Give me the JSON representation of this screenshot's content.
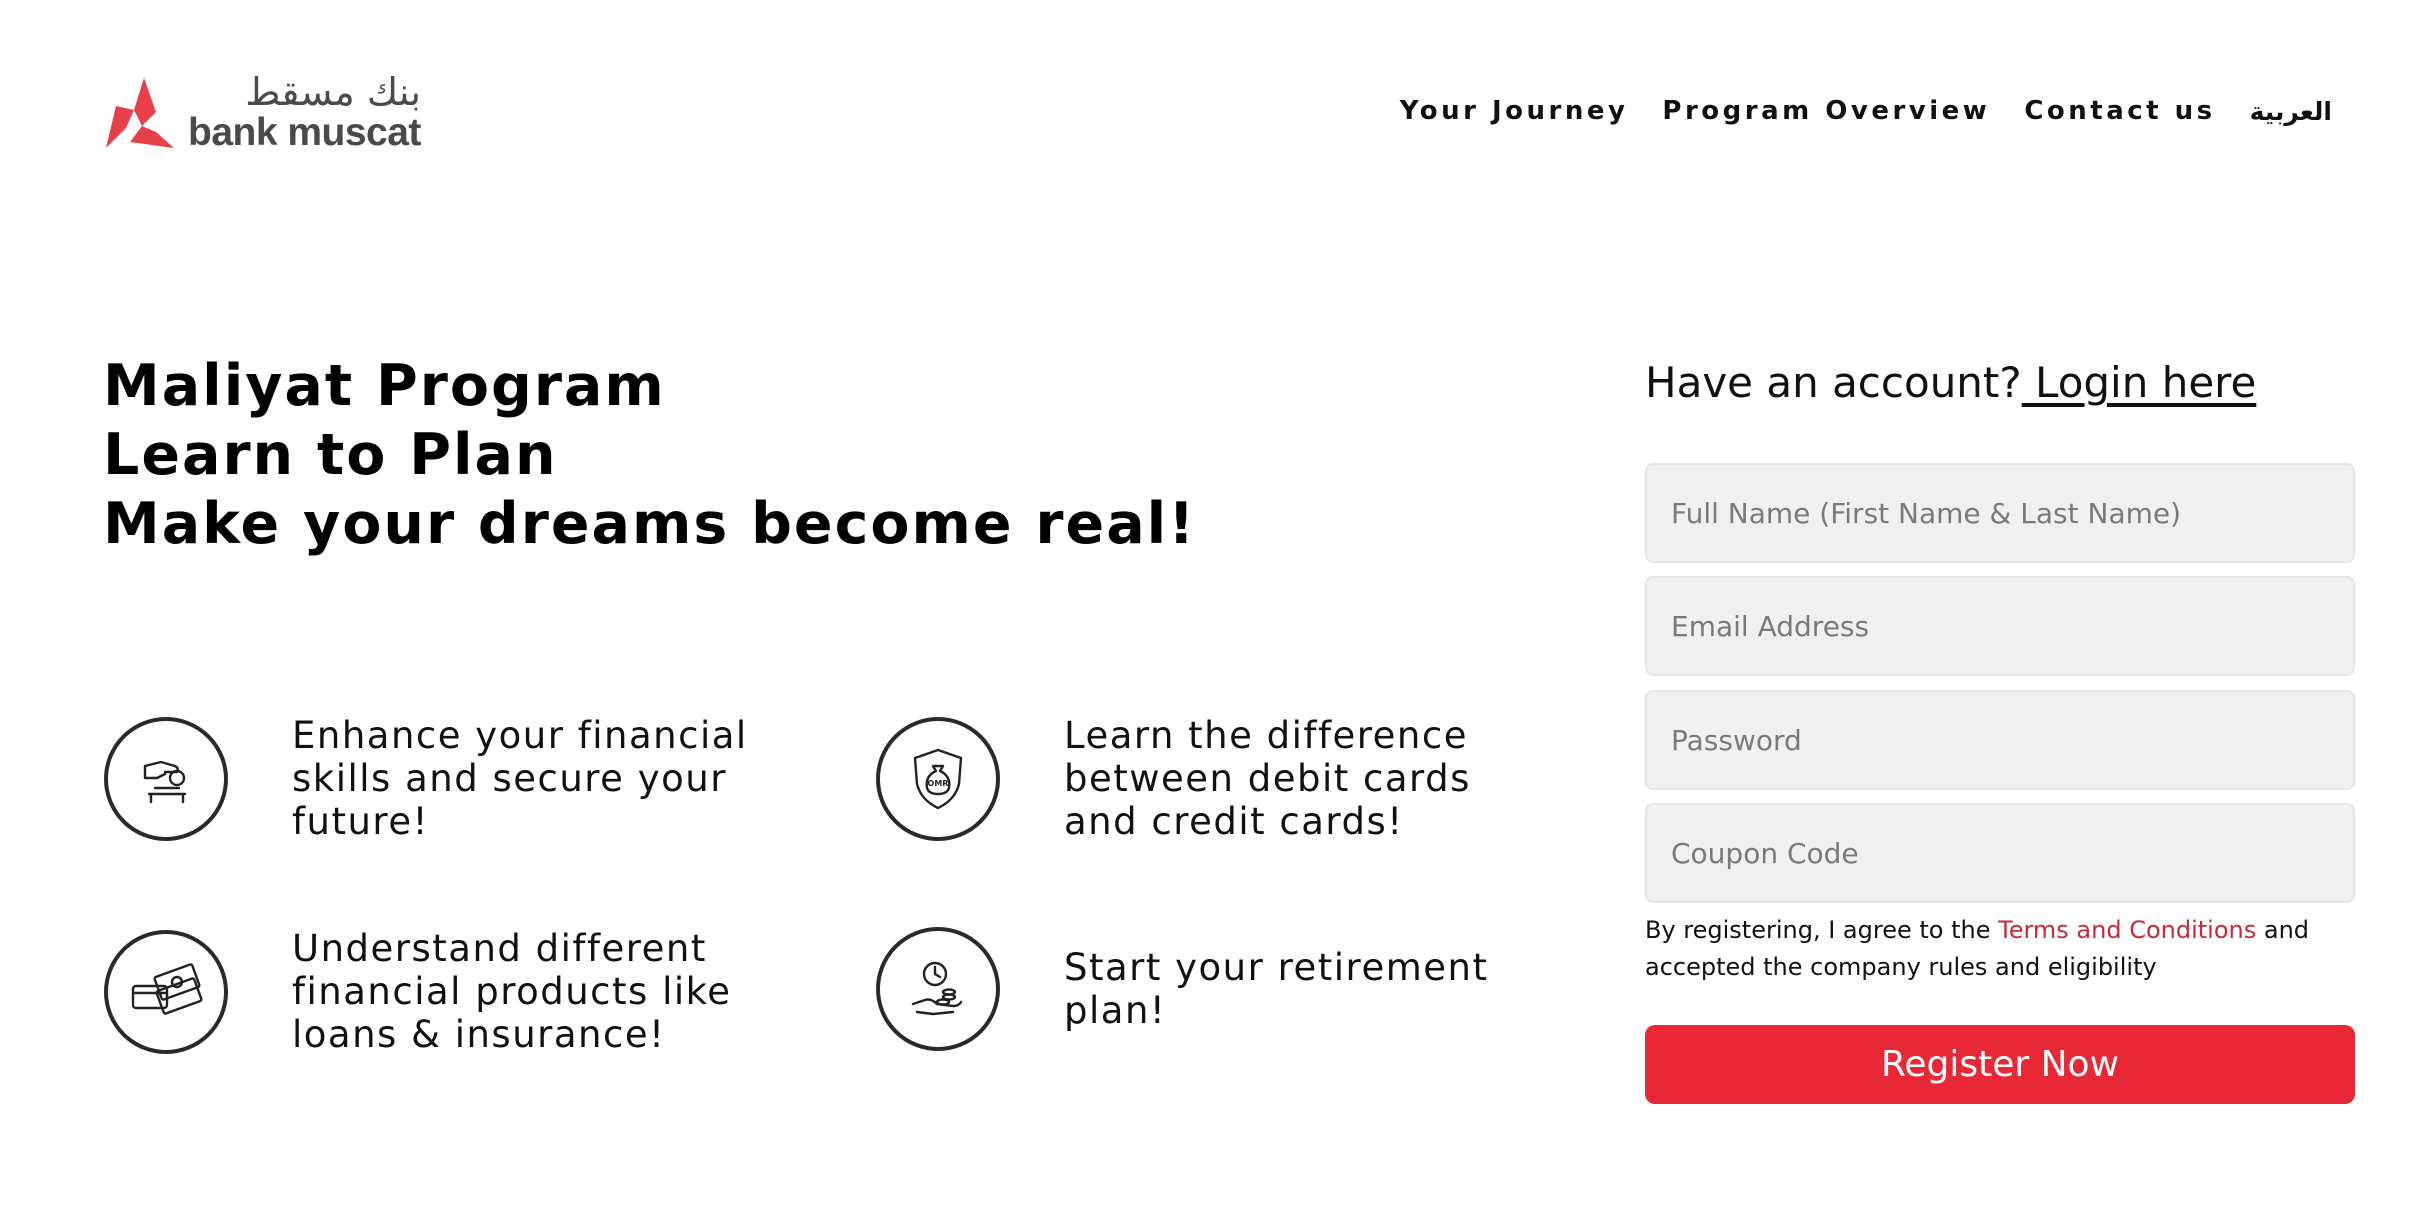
{
  "brand": {
    "name_ar": "بنك مسقط",
    "name_en": "bank muscat",
    "accent_color": "#e82836"
  },
  "nav": {
    "items": [
      {
        "label": "Your Journey"
      },
      {
        "label": "Program Overview"
      },
      {
        "label": "Contact us"
      },
      {
        "label": "العربية"
      }
    ]
  },
  "hero": {
    "lines": [
      "Maliyat Program",
      "Learn to Plan",
      "Make your dreams become real!"
    ]
  },
  "features": [
    {
      "icon": "hand-coin-deposit-icon",
      "text": "Enhance your financial skills and secure your future!"
    },
    {
      "icon": "shield-money-bag-icon",
      "text": "Learn the difference between debit cards and credit cards!"
    },
    {
      "icon": "cards-and-cash-icon",
      "text": "Understand different financial products like loans & insurance!"
    },
    {
      "icon": "clock-hand-coins-icon",
      "text": "Start your retirement plan!"
    }
  ],
  "form": {
    "have_account": "Have an account?",
    "login_link": " Login here",
    "fields": {
      "full_name": {
        "placeholder": "Full Name (First Name & Last Name)",
        "value": ""
      },
      "email": {
        "placeholder": "Email Address",
        "value": ""
      },
      "password": {
        "placeholder": "Password",
        "value": ""
      },
      "coupon": {
        "placeholder": "Coupon Code",
        "value": ""
      }
    },
    "terms_prefix": "By registering, I agree to the ",
    "terms_link": "Terms and Conditions",
    "terms_suffix": " and accepted the company rules and eligibility",
    "submit_label": "Register Now"
  }
}
